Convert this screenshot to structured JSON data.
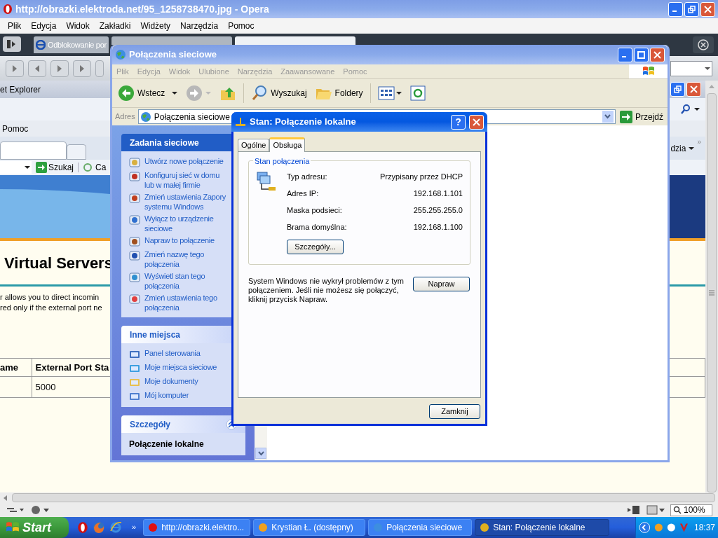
{
  "opera": {
    "title": "http://obrazki.elektroda.net/95_1258738470.jpg - Opera",
    "active": false,
    "menu": [
      "Plik",
      "Edycja",
      "Widok",
      "Zakładki",
      "Widżety",
      "Narzędzia",
      "Pomoc"
    ],
    "tabs": [
      {
        "label": "Odblokowanie por",
        "selected": false
      },
      {
        "selected": false
      },
      {
        "selected": true
      }
    ],
    "zoom": "100%"
  },
  "screenshot": {
    "ie_title": "et Explorer",
    "ie_menu_item": "Pomoc",
    "search_button": "Szukaj",
    "toolbar_item": "Ca",
    "right_menu": "dzia",
    "right_more": "»",
    "heading": "Virtual Servers",
    "intro": [
      "r allows you to direct incomin",
      "red only if the external port ne"
    ],
    "table": {
      "columns": [
        "ame",
        "External Port Sta"
      ],
      "rows": [
        [
          "",
          "5000"
        ]
      ]
    }
  },
  "explorer": {
    "title": "Połączenia sieciowe",
    "active": false,
    "menu": [
      "Plik",
      "Edycja",
      "Widok",
      "Ulubione",
      "Narzędzia",
      "Zaawansowane",
      "Pomoc"
    ],
    "toolbar": {
      "back": "Wstecz",
      "search": "Wyszukaj",
      "folders": "Foldery"
    },
    "address": {
      "label": "Adres",
      "value": "Połączenia sieciowe",
      "go": "Przejdź"
    },
    "panels": [
      {
        "title": "Zadania sieciowe",
        "kind": "primary",
        "links": [
          "Utwórz nowe połączenie",
          "Konfiguruj sieć w domu lub w małej firmie",
          "Zmień ustawienia Zapory systemu Windows",
          "Wyłącz to urządzenie sieciowe",
          "Napraw to połączenie",
          "Zmień nazwę tego połączenia",
          "Wyświetl stan tego połączenia",
          "Zmień ustawienia tego połączenia"
        ]
      },
      {
        "title": "Inne miejsca",
        "kind": "secondary",
        "links": [
          "Panel sterowania",
          "Moje miejsca sieciowe",
          "Moje dokumenty",
          "Mój komputer"
        ]
      },
      {
        "title": "Szczegóły",
        "kind": "details",
        "expanded": true,
        "detail": "Połączenie lokalne"
      }
    ]
  },
  "dialog": {
    "title": "Stan: Połączenie lokalne",
    "active": true,
    "help_button": "?",
    "tabs": [
      {
        "label": "Ogólne",
        "selected": false
      },
      {
        "label": "Obsługa",
        "selected": true
      }
    ],
    "group": {
      "title": "Stan połączenia",
      "rows": [
        {
          "label": "Typ adresu:",
          "value": "Przypisany przez DHCP"
        },
        {
          "label": "Adres IP:",
          "value": "192.168.1.101"
        },
        {
          "label": "Maska podsieci:",
          "value": "255.255.255.0"
        },
        {
          "label": "Brama domyślna:",
          "value": "192.168.1.100"
        }
      ],
      "details_button": "Szczegóły..."
    },
    "message": "System Windows nie wykrył problemów z tym połączeniem. Jeśli nie możesz się połączyć, kliknij przycisk Napraw.",
    "repair_button": "Napraw",
    "close_button": "Zamknij"
  },
  "taskbar": {
    "start": "Start",
    "more": "»",
    "items": [
      {
        "label": "http://obrazki.elektro...",
        "selected": false
      },
      {
        "label": "Krystian Ł. (dostępny)",
        "selected": false
      },
      {
        "label": "Połączenia sieciowe",
        "selected": false
      },
      {
        "label": "Stan: Połączenie lokalne",
        "selected": true
      }
    ],
    "clock": "18:37"
  }
}
